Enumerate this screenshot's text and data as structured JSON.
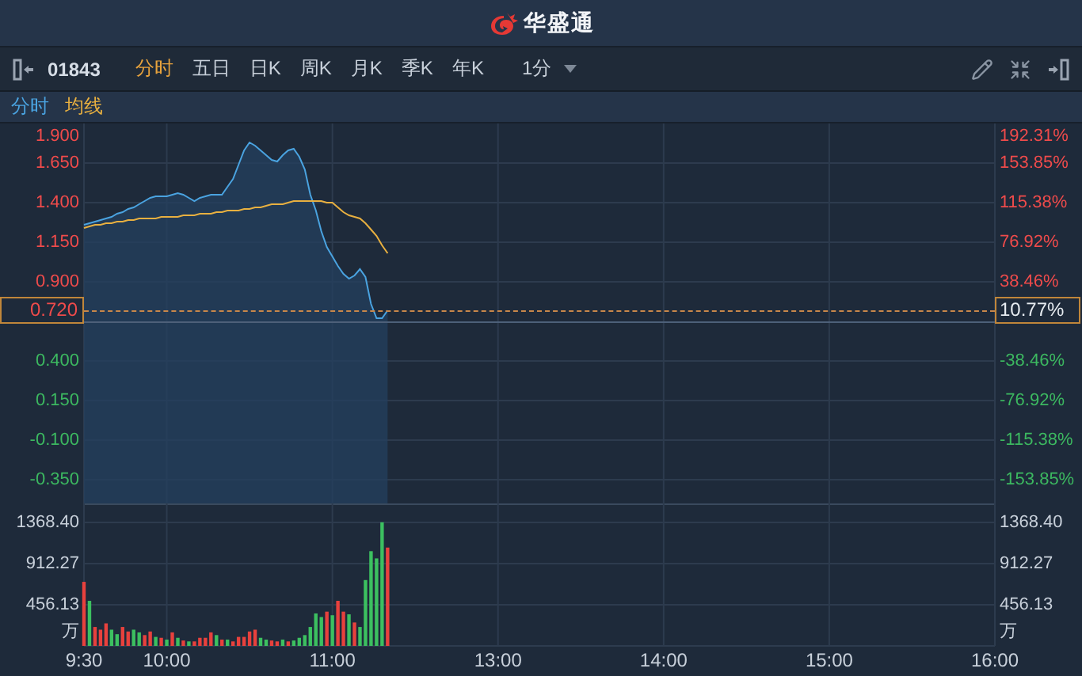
{
  "header": {
    "logo_text": "华盛通"
  },
  "toolbar": {
    "code": "01843",
    "tabs": [
      {
        "label": "分时",
        "selected": true
      },
      {
        "label": "五日",
        "selected": false
      },
      {
        "label": "日K",
        "selected": false
      },
      {
        "label": "周K",
        "selected": false
      },
      {
        "label": "月K",
        "selected": false
      },
      {
        "label": "季K",
        "selected": false
      },
      {
        "label": "年K",
        "selected": false
      }
    ],
    "interval": "1分"
  },
  "price_chart": {
    "top_label": "1.900",
    "top_right_label": "192.31%",
    "current_price": "0.720",
    "current_change": "10.77%",
    "chart_data": {
      "type": "line",
      "grid": true,
      "categories": [
        null,
        null,
        null,
        null,
        null,
        null,
        null,
        null,
        null,
        null,
        null,
        null,
        null,
        null,
        null,
        null,
        null,
        null,
        null,
        null,
        null,
        null,
        null,
        null,
        null,
        null,
        null,
        null,
        null,
        null,
        null,
        null,
        null,
        null,
        null,
        null,
        null,
        null,
        null,
        null,
        null,
        null,
        null,
        null,
        null,
        null,
        null,
        null,
        null,
        null,
        null,
        null,
        null,
        null,
        null,
        null,
        null,
        null,
        null,
        null,
        null,
        null,
        null,
        null,
        null,
        null,
        null,
        null,
        null,
        null,
        null,
        null,
        null,
        null,
        null,
        null,
        null,
        null,
        null,
        null,
        null,
        null,
        null,
        null,
        null,
        null,
        null,
        null,
        null,
        null,
        null,
        null,
        null,
        null,
        null,
        null,
        null,
        null,
        null,
        null,
        null,
        null,
        null,
        null,
        null,
        null,
        null,
        null,
        null,
        null,
        null,
        null,
        null,
        null,
        null,
        null,
        null,
        null,
        null,
        null,
        null,
        null,
        null,
        null,
        null,
        null,
        null,
        null,
        null,
        null,
        null,
        null,
        null,
        null,
        null,
        null,
        null,
        null,
        null,
        null,
        null,
        null,
        null,
        null,
        null,
        null,
        null,
        null,
        null,
        null,
        null,
        null,
        null,
        null,
        null,
        null,
        null,
        null,
        null,
        null,
        null,
        null,
        null,
        null,
        null,
        null
      ],
      "series": [
        {
          "name": "分时",
          "color": "#4aa3e0",
          "values": [
            1.26,
            1.27,
            1.28,
            1.29,
            1.3,
            1.31,
            1.33,
            1.34,
            1.36,
            1.37,
            1.39,
            1.41,
            1.43,
            1.44,
            1.44,
            1.44,
            1.45,
            1.46,
            1.45,
            1.43,
            1.41,
            1.43,
            1.44,
            1.45,
            1.45,
            1.45,
            1.5,
            1.55,
            1.64,
            1.73,
            1.78,
            1.76,
            1.73,
            1.7,
            1.67,
            1.66,
            1.7,
            1.73,
            1.74,
            1.69,
            1.61,
            1.45,
            1.35,
            1.22,
            1.12,
            1.06,
            1.0,
            0.95,
            0.92,
            0.94,
            0.98,
            0.93,
            0.76,
            0.67,
            0.67,
            0.72,
            null,
            null,
            null,
            null,
            null,
            null,
            null,
            null,
            null,
            null,
            null,
            null,
            null,
            null,
            null,
            null,
            null,
            null,
            null,
            null,
            null,
            null,
            null,
            null,
            null,
            null,
            null,
            null,
            null,
            null,
            null,
            null,
            null,
            null,
            null,
            null,
            null,
            null,
            null,
            null,
            null,
            null,
            null,
            null,
            null,
            null,
            null,
            null,
            null,
            null,
            null,
            null,
            null,
            null,
            null,
            null,
            null,
            null,
            null,
            null,
            null,
            null,
            null,
            null,
            null,
            null,
            null,
            null,
            null,
            null,
            null,
            null,
            null,
            null,
            null,
            null,
            null,
            null,
            null,
            null,
            null,
            null,
            null,
            null,
            null,
            null,
            null,
            null,
            null,
            null,
            null,
            null,
            null,
            null,
            null,
            null,
            null,
            null,
            null,
            null,
            null,
            null,
            null,
            null,
            null,
            null,
            null,
            null,
            null,
            null
          ]
        },
        {
          "name": "均线",
          "color": "#e8b040",
          "values": [
            1.24,
            1.25,
            1.26,
            1.26,
            1.27,
            1.27,
            1.28,
            1.28,
            1.29,
            1.29,
            1.3,
            1.3,
            1.3,
            1.3,
            1.31,
            1.31,
            1.31,
            1.31,
            1.32,
            1.32,
            1.32,
            1.33,
            1.33,
            1.33,
            1.34,
            1.34,
            1.35,
            1.35,
            1.35,
            1.36,
            1.36,
            1.37,
            1.37,
            1.38,
            1.39,
            1.39,
            1.39,
            1.4,
            1.41,
            1.41,
            1.41,
            1.41,
            1.41,
            1.41,
            1.4,
            1.4,
            1.37,
            1.34,
            1.32,
            1.31,
            1.3,
            1.27,
            1.23,
            1.19,
            1.13,
            1.08,
            null,
            null,
            null,
            null,
            null,
            null,
            null,
            null,
            null,
            null,
            null,
            null,
            null,
            null,
            null,
            null,
            null,
            null,
            null,
            null,
            null,
            null,
            null,
            null,
            null,
            null,
            null,
            null,
            null,
            null,
            null,
            null,
            null,
            null,
            null,
            null,
            null,
            null,
            null,
            null,
            null,
            null,
            null,
            null,
            null,
            null,
            null,
            null,
            null,
            null,
            null,
            null,
            null,
            null,
            null,
            null,
            null,
            null,
            null,
            null,
            null,
            null,
            null,
            null,
            null,
            null,
            null,
            null,
            null,
            null,
            null,
            null,
            null,
            null,
            null,
            null,
            null,
            null,
            null,
            null,
            null,
            null,
            null,
            null,
            null,
            null,
            null,
            null,
            null,
            null,
            null,
            null,
            null,
            null,
            null,
            null,
            null,
            null,
            null,
            null,
            null,
            null,
            null,
            null,
            null,
            null,
            null,
            null,
            null,
            null
          ]
        }
      ],
      "ylim": [
        -0.5,
        1.9
      ],
      "yticks": [
        {
          "value": 1.65,
          "label": "1.650"
        },
        {
          "value": 1.4,
          "label": "1.400"
        },
        {
          "value": 1.15,
          "label": "1.150"
        },
        {
          "value": 0.9,
          "label": "0.900"
        },
        {
          "value": 0.4,
          "label": "0.400"
        },
        {
          "value": 0.15,
          "label": "0.150"
        },
        {
          "value": -0.1,
          "label": "-0.100"
        },
        {
          "value": -0.35,
          "label": "-0.350"
        }
      ]
    },
    "right_axis_labels": [
      "153.85%",
      "115.38%",
      "76.92%",
      "38.46%",
      "-38.46%",
      "-76.92%",
      "-115.38%",
      "-153.85%"
    ]
  },
  "volume_chart": {
    "unit_labels": [
      "万",
      "万"
    ],
    "chart_data": {
      "type": "bar",
      "grid": true,
      "categories": [
        "9:30",
        null,
        null,
        null,
        null,
        null,
        null,
        null,
        null,
        null,
        null,
        null,
        null,
        null,
        null,
        "10:00",
        null,
        null,
        null,
        null,
        null,
        null,
        null,
        null,
        null,
        null,
        null,
        null,
        null,
        null,
        null,
        null,
        null,
        null,
        null,
        null,
        null,
        null,
        null,
        null,
        null,
        null,
        null,
        null,
        null,
        "11:00",
        null,
        null,
        null,
        null,
        null,
        null,
        null,
        null,
        null,
        null,
        null,
        null,
        null,
        null,
        null,
        null,
        null,
        null,
        null,
        null,
        null,
        null,
        null,
        null,
        null,
        null,
        null,
        null,
        null,
        "13:00",
        null,
        null,
        null,
        null,
        null,
        null,
        null,
        null,
        null,
        null,
        null,
        null,
        null,
        null,
        null,
        null,
        null,
        null,
        null,
        null,
        null,
        null,
        null,
        null,
        null,
        null,
        null,
        null,
        null,
        "14:00",
        null,
        null,
        null,
        null,
        null,
        null,
        null,
        null,
        null,
        null,
        null,
        null,
        null,
        null,
        null,
        null,
        null,
        null,
        null,
        null,
        null,
        null,
        null,
        null,
        null,
        null,
        null,
        null,
        null,
        "15:00",
        null,
        null,
        null,
        null,
        null,
        null,
        null,
        null,
        null,
        null,
        null,
        null,
        null,
        null,
        null,
        null,
        null,
        null,
        null,
        null,
        null,
        null,
        null,
        null,
        null,
        null,
        null,
        null,
        null,
        "16:00"
      ],
      "series": [
        {
          "color": "#e8413d",
          "values": [
            710,
            null,
            210,
            180,
            250,
            null,
            null,
            210,
            160,
            null,
            null,
            120,
            160,
            null,
            90,
            null,
            150,
            null,
            60,
            null,
            50,
            90,
            90,
            150,
            null,
            70,
            null,
            50,
            100,
            100,
            160,
            180,
            null,
            null,
            60,
            50,
            null,
            50,
            null,
            null,
            null,
            null,
            null,
            null,
            380,
            null,
            500,
            380,
            null,
            260,
            null,
            null,
            null,
            null,
            null,
            1090,
            null,
            null,
            null,
            null,
            null,
            null,
            null,
            null,
            null,
            null,
            null,
            null,
            null,
            null,
            null,
            null,
            null,
            null,
            null,
            null,
            null,
            null,
            null,
            null,
            null,
            null,
            null,
            null,
            null,
            null,
            null,
            null,
            null,
            null,
            null,
            null,
            null,
            null,
            null,
            null,
            null,
            null,
            null,
            null,
            null,
            null,
            null,
            null,
            null,
            null,
            null,
            null,
            null,
            null,
            null,
            null,
            null,
            null,
            null,
            null,
            null,
            null,
            null,
            null,
            null,
            null,
            null,
            null,
            null,
            null,
            null,
            null,
            null,
            null,
            null,
            null,
            null,
            null,
            null,
            null,
            null,
            null,
            null,
            null,
            null,
            null,
            null,
            null,
            null,
            null,
            null,
            null,
            null,
            null,
            null,
            null,
            null,
            null,
            null,
            null,
            null,
            null,
            null,
            null,
            null,
            null,
            null,
            null,
            null,
            null
          ]
        },
        {
          "color": "#3cc060",
          "values": [
            null,
            500,
            null,
            null,
            null,
            180,
            130,
            null,
            null,
            180,
            150,
            null,
            null,
            100,
            null,
            70,
            null,
            90,
            null,
            50,
            null,
            null,
            null,
            null,
            120,
            null,
            70,
            null,
            null,
            null,
            null,
            null,
            90,
            70,
            null,
            null,
            70,
            null,
            60,
            90,
            120,
            210,
            360,
            320,
            null,
            340,
            null,
            null,
            350,
            null,
            210,
            730,
            1050,
            970,
            1370,
            null,
            null,
            null,
            null,
            null,
            null,
            null,
            null,
            null,
            null,
            null,
            null,
            null,
            null,
            null,
            null,
            null,
            null,
            null,
            null,
            null,
            null,
            null,
            null,
            null,
            null,
            null,
            null,
            null,
            null,
            null,
            null,
            null,
            null,
            null,
            null,
            null,
            null,
            null,
            null,
            null,
            null,
            null,
            null,
            null,
            null,
            null,
            null,
            null,
            null,
            null,
            null,
            null,
            null,
            null,
            null,
            null,
            null,
            null,
            null,
            null,
            null,
            null,
            null,
            null,
            null,
            null,
            null,
            null,
            null,
            null,
            null,
            null,
            null,
            null,
            null,
            null,
            null,
            null,
            null,
            null,
            null,
            null,
            null,
            null,
            null,
            null,
            null,
            null,
            null,
            null,
            null,
            null,
            null,
            null,
            null,
            null,
            null,
            null,
            null,
            null,
            null,
            null,
            null,
            null,
            null,
            null,
            null,
            null,
            null,
            null
          ]
        }
      ],
      "ylim": [
        0,
        1579
      ],
      "yticks": [
        {
          "value": 1368.4,
          "label": "1368.40"
        },
        {
          "value": 912.27,
          "label": "912.27"
        },
        {
          "value": 456.13,
          "label": "456.13"
        }
      ]
    },
    "right_axis_labels": [
      "1368.40",
      "912.27",
      "456.13"
    ]
  }
}
